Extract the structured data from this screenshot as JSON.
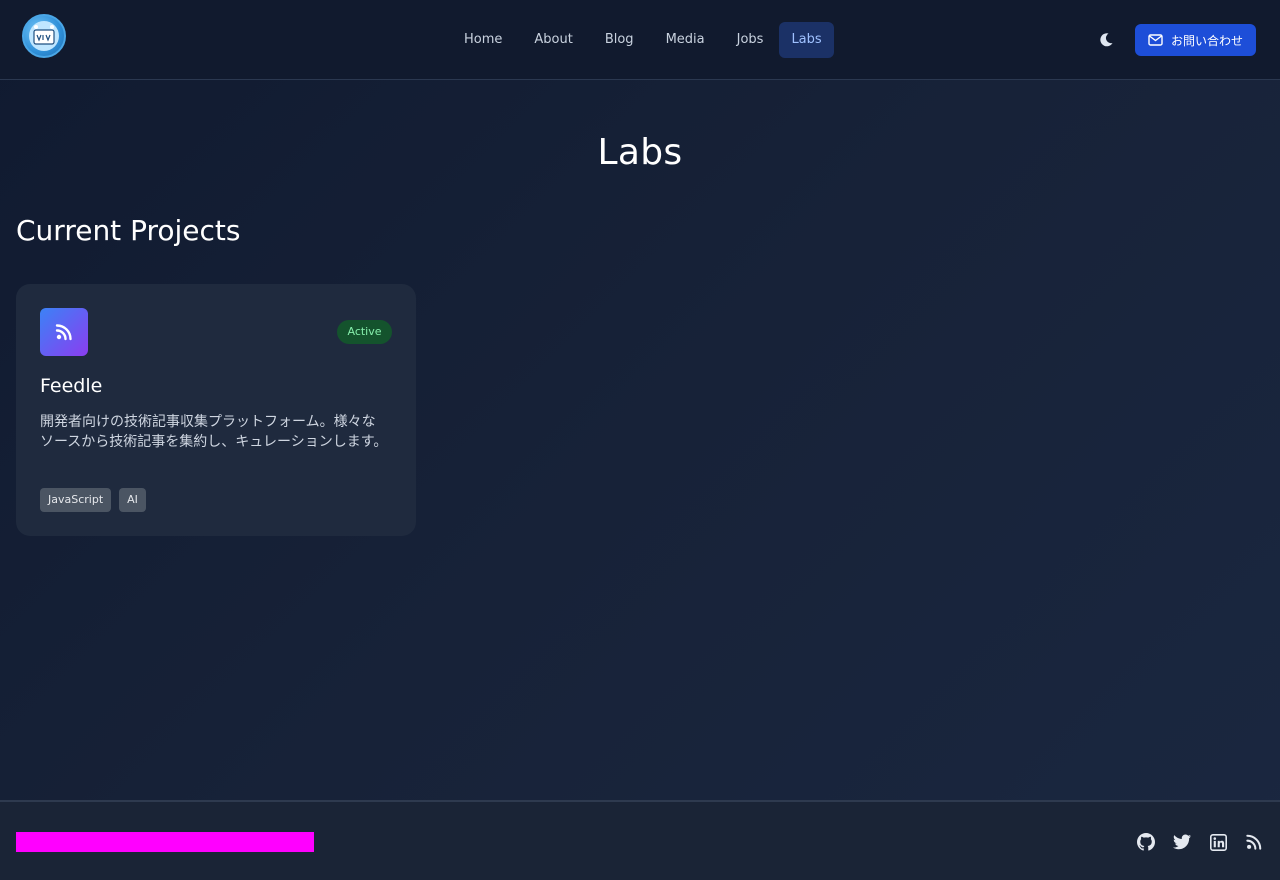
{
  "header": {
    "logo_icon": "cartoon-avatar-logo",
    "nav": [
      {
        "label": "Home",
        "active": false
      },
      {
        "label": "About",
        "active": false
      },
      {
        "label": "Blog",
        "active": false
      },
      {
        "label": "Media",
        "active": false
      },
      {
        "label": "Jobs",
        "active": false
      },
      {
        "label": "Labs",
        "active": true
      }
    ],
    "theme_icon": "moon-icon",
    "contact": {
      "label": "お問い合わせ",
      "icon": "mail-icon"
    }
  },
  "main": {
    "title": "Labs",
    "section_title": "Current Projects",
    "projects": [
      {
        "icon": "rss-icon",
        "status": "Active",
        "name": "Feedle",
        "description": "開発者向けの技術記事収集プラットフォーム。様々なソースから技術記事を集約し、キュレーションします。",
        "tags": [
          "JavaScript",
          "AI"
        ]
      }
    ]
  },
  "footer": {
    "social_icons": [
      "github-icon",
      "twitter-icon",
      "linkedin-icon",
      "rss-icon"
    ]
  },
  "colors": {
    "background": "#131d33",
    "header_bg": "#111a2e",
    "nav_active_bg": "#1b3166",
    "nav_active_text": "#9fc1ff",
    "contact_button": "#1d4ed8",
    "card_bg": "#1f2a3e",
    "status_badge_bg": "#14532d",
    "status_badge_text": "#86efac",
    "footer_redacted_block": "#ff00ff"
  }
}
